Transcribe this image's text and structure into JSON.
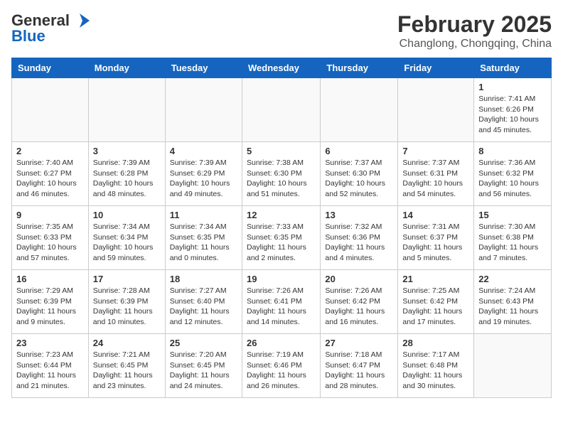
{
  "header": {
    "logo_general": "General",
    "logo_blue": "Blue",
    "title": "February 2025",
    "location": "Changlong, Chongqing, China"
  },
  "days_of_week": [
    "Sunday",
    "Monday",
    "Tuesday",
    "Wednesday",
    "Thursday",
    "Friday",
    "Saturday"
  ],
  "weeks": [
    [
      {
        "day": "",
        "info": ""
      },
      {
        "day": "",
        "info": ""
      },
      {
        "day": "",
        "info": ""
      },
      {
        "day": "",
        "info": ""
      },
      {
        "day": "",
        "info": ""
      },
      {
        "day": "",
        "info": ""
      },
      {
        "day": "1",
        "info": "Sunrise: 7:41 AM\nSunset: 6:26 PM\nDaylight: 10 hours\nand 45 minutes."
      }
    ],
    [
      {
        "day": "2",
        "info": "Sunrise: 7:40 AM\nSunset: 6:27 PM\nDaylight: 10 hours\nand 46 minutes."
      },
      {
        "day": "3",
        "info": "Sunrise: 7:39 AM\nSunset: 6:28 PM\nDaylight: 10 hours\nand 48 minutes."
      },
      {
        "day": "4",
        "info": "Sunrise: 7:39 AM\nSunset: 6:29 PM\nDaylight: 10 hours\nand 49 minutes."
      },
      {
        "day": "5",
        "info": "Sunrise: 7:38 AM\nSunset: 6:30 PM\nDaylight: 10 hours\nand 51 minutes."
      },
      {
        "day": "6",
        "info": "Sunrise: 7:37 AM\nSunset: 6:30 PM\nDaylight: 10 hours\nand 52 minutes."
      },
      {
        "day": "7",
        "info": "Sunrise: 7:37 AM\nSunset: 6:31 PM\nDaylight: 10 hours\nand 54 minutes."
      },
      {
        "day": "8",
        "info": "Sunrise: 7:36 AM\nSunset: 6:32 PM\nDaylight: 10 hours\nand 56 minutes."
      }
    ],
    [
      {
        "day": "9",
        "info": "Sunrise: 7:35 AM\nSunset: 6:33 PM\nDaylight: 10 hours\nand 57 minutes."
      },
      {
        "day": "10",
        "info": "Sunrise: 7:34 AM\nSunset: 6:34 PM\nDaylight: 10 hours\nand 59 minutes."
      },
      {
        "day": "11",
        "info": "Sunrise: 7:34 AM\nSunset: 6:35 PM\nDaylight: 11 hours\nand 0 minutes."
      },
      {
        "day": "12",
        "info": "Sunrise: 7:33 AM\nSunset: 6:35 PM\nDaylight: 11 hours\nand 2 minutes."
      },
      {
        "day": "13",
        "info": "Sunrise: 7:32 AM\nSunset: 6:36 PM\nDaylight: 11 hours\nand 4 minutes."
      },
      {
        "day": "14",
        "info": "Sunrise: 7:31 AM\nSunset: 6:37 PM\nDaylight: 11 hours\nand 5 minutes."
      },
      {
        "day": "15",
        "info": "Sunrise: 7:30 AM\nSunset: 6:38 PM\nDaylight: 11 hours\nand 7 minutes."
      }
    ],
    [
      {
        "day": "16",
        "info": "Sunrise: 7:29 AM\nSunset: 6:39 PM\nDaylight: 11 hours\nand 9 minutes."
      },
      {
        "day": "17",
        "info": "Sunrise: 7:28 AM\nSunset: 6:39 PM\nDaylight: 11 hours\nand 10 minutes."
      },
      {
        "day": "18",
        "info": "Sunrise: 7:27 AM\nSunset: 6:40 PM\nDaylight: 11 hours\nand 12 minutes."
      },
      {
        "day": "19",
        "info": "Sunrise: 7:26 AM\nSunset: 6:41 PM\nDaylight: 11 hours\nand 14 minutes."
      },
      {
        "day": "20",
        "info": "Sunrise: 7:26 AM\nSunset: 6:42 PM\nDaylight: 11 hours\nand 16 minutes."
      },
      {
        "day": "21",
        "info": "Sunrise: 7:25 AM\nSunset: 6:42 PM\nDaylight: 11 hours\nand 17 minutes."
      },
      {
        "day": "22",
        "info": "Sunrise: 7:24 AM\nSunset: 6:43 PM\nDaylight: 11 hours\nand 19 minutes."
      }
    ],
    [
      {
        "day": "23",
        "info": "Sunrise: 7:23 AM\nSunset: 6:44 PM\nDaylight: 11 hours\nand 21 minutes."
      },
      {
        "day": "24",
        "info": "Sunrise: 7:21 AM\nSunset: 6:45 PM\nDaylight: 11 hours\nand 23 minutes."
      },
      {
        "day": "25",
        "info": "Sunrise: 7:20 AM\nSunset: 6:45 PM\nDaylight: 11 hours\nand 24 minutes."
      },
      {
        "day": "26",
        "info": "Sunrise: 7:19 AM\nSunset: 6:46 PM\nDaylight: 11 hours\nand 26 minutes."
      },
      {
        "day": "27",
        "info": "Sunrise: 7:18 AM\nSunset: 6:47 PM\nDaylight: 11 hours\nand 28 minutes."
      },
      {
        "day": "28",
        "info": "Sunrise: 7:17 AM\nSunset: 6:48 PM\nDaylight: 11 hours\nand 30 minutes."
      },
      {
        "day": "",
        "info": ""
      }
    ]
  ]
}
